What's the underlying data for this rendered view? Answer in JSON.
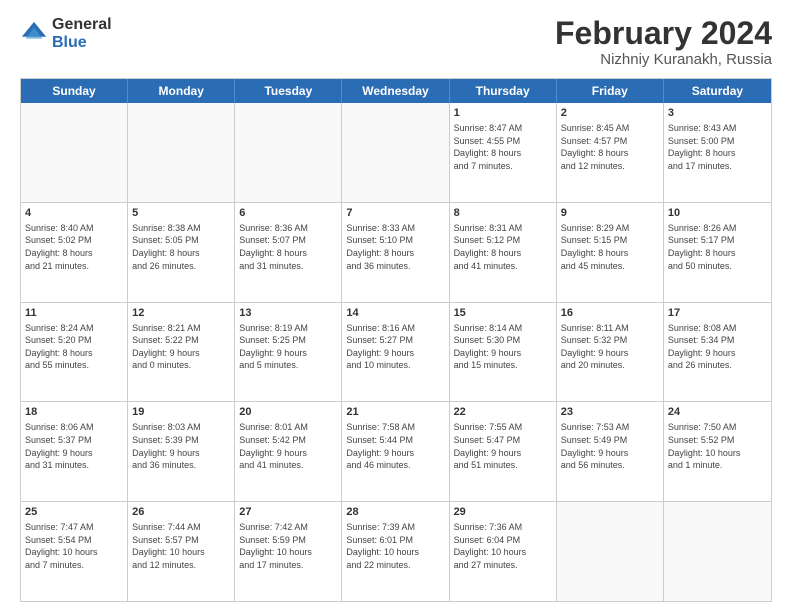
{
  "header": {
    "logo": {
      "general": "General",
      "blue": "Blue"
    },
    "title": "February 2024",
    "location": "Nizhniy Kuranakh, Russia"
  },
  "days_of_week": [
    "Sunday",
    "Monday",
    "Tuesday",
    "Wednesday",
    "Thursday",
    "Friday",
    "Saturday"
  ],
  "weeks": [
    [
      {
        "day": "",
        "empty": true
      },
      {
        "day": "",
        "empty": true
      },
      {
        "day": "",
        "empty": true
      },
      {
        "day": "",
        "empty": true
      },
      {
        "day": "1",
        "lines": [
          "Sunrise: 8:47 AM",
          "Sunset: 4:55 PM",
          "Daylight: 8 hours",
          "and 7 minutes."
        ]
      },
      {
        "day": "2",
        "lines": [
          "Sunrise: 8:45 AM",
          "Sunset: 4:57 PM",
          "Daylight: 8 hours",
          "and 12 minutes."
        ]
      },
      {
        "day": "3",
        "lines": [
          "Sunrise: 8:43 AM",
          "Sunset: 5:00 PM",
          "Daylight: 8 hours",
          "and 17 minutes."
        ]
      }
    ],
    [
      {
        "day": "4",
        "lines": [
          "Sunrise: 8:40 AM",
          "Sunset: 5:02 PM",
          "Daylight: 8 hours",
          "and 21 minutes."
        ]
      },
      {
        "day": "5",
        "lines": [
          "Sunrise: 8:38 AM",
          "Sunset: 5:05 PM",
          "Daylight: 8 hours",
          "and 26 minutes."
        ]
      },
      {
        "day": "6",
        "lines": [
          "Sunrise: 8:36 AM",
          "Sunset: 5:07 PM",
          "Daylight: 8 hours",
          "and 31 minutes."
        ]
      },
      {
        "day": "7",
        "lines": [
          "Sunrise: 8:33 AM",
          "Sunset: 5:10 PM",
          "Daylight: 8 hours",
          "and 36 minutes."
        ]
      },
      {
        "day": "8",
        "lines": [
          "Sunrise: 8:31 AM",
          "Sunset: 5:12 PM",
          "Daylight: 8 hours",
          "and 41 minutes."
        ]
      },
      {
        "day": "9",
        "lines": [
          "Sunrise: 8:29 AM",
          "Sunset: 5:15 PM",
          "Daylight: 8 hours",
          "and 45 minutes."
        ]
      },
      {
        "day": "10",
        "lines": [
          "Sunrise: 8:26 AM",
          "Sunset: 5:17 PM",
          "Daylight: 8 hours",
          "and 50 minutes."
        ]
      }
    ],
    [
      {
        "day": "11",
        "lines": [
          "Sunrise: 8:24 AM",
          "Sunset: 5:20 PM",
          "Daylight: 8 hours",
          "and 55 minutes."
        ]
      },
      {
        "day": "12",
        "lines": [
          "Sunrise: 8:21 AM",
          "Sunset: 5:22 PM",
          "Daylight: 9 hours",
          "and 0 minutes."
        ]
      },
      {
        "day": "13",
        "lines": [
          "Sunrise: 8:19 AM",
          "Sunset: 5:25 PM",
          "Daylight: 9 hours",
          "and 5 minutes."
        ]
      },
      {
        "day": "14",
        "lines": [
          "Sunrise: 8:16 AM",
          "Sunset: 5:27 PM",
          "Daylight: 9 hours",
          "and 10 minutes."
        ]
      },
      {
        "day": "15",
        "lines": [
          "Sunrise: 8:14 AM",
          "Sunset: 5:30 PM",
          "Daylight: 9 hours",
          "and 15 minutes."
        ]
      },
      {
        "day": "16",
        "lines": [
          "Sunrise: 8:11 AM",
          "Sunset: 5:32 PM",
          "Daylight: 9 hours",
          "and 20 minutes."
        ]
      },
      {
        "day": "17",
        "lines": [
          "Sunrise: 8:08 AM",
          "Sunset: 5:34 PM",
          "Daylight: 9 hours",
          "and 26 minutes."
        ]
      }
    ],
    [
      {
        "day": "18",
        "lines": [
          "Sunrise: 8:06 AM",
          "Sunset: 5:37 PM",
          "Daylight: 9 hours",
          "and 31 minutes."
        ]
      },
      {
        "day": "19",
        "lines": [
          "Sunrise: 8:03 AM",
          "Sunset: 5:39 PM",
          "Daylight: 9 hours",
          "and 36 minutes."
        ]
      },
      {
        "day": "20",
        "lines": [
          "Sunrise: 8:01 AM",
          "Sunset: 5:42 PM",
          "Daylight: 9 hours",
          "and 41 minutes."
        ]
      },
      {
        "day": "21",
        "lines": [
          "Sunrise: 7:58 AM",
          "Sunset: 5:44 PM",
          "Daylight: 9 hours",
          "and 46 minutes."
        ]
      },
      {
        "day": "22",
        "lines": [
          "Sunrise: 7:55 AM",
          "Sunset: 5:47 PM",
          "Daylight: 9 hours",
          "and 51 minutes."
        ]
      },
      {
        "day": "23",
        "lines": [
          "Sunrise: 7:53 AM",
          "Sunset: 5:49 PM",
          "Daylight: 9 hours",
          "and 56 minutes."
        ]
      },
      {
        "day": "24",
        "lines": [
          "Sunrise: 7:50 AM",
          "Sunset: 5:52 PM",
          "Daylight: 10 hours",
          "and 1 minute."
        ]
      }
    ],
    [
      {
        "day": "25",
        "lines": [
          "Sunrise: 7:47 AM",
          "Sunset: 5:54 PM",
          "Daylight: 10 hours",
          "and 7 minutes."
        ]
      },
      {
        "day": "26",
        "lines": [
          "Sunrise: 7:44 AM",
          "Sunset: 5:57 PM",
          "Daylight: 10 hours",
          "and 12 minutes."
        ]
      },
      {
        "day": "27",
        "lines": [
          "Sunrise: 7:42 AM",
          "Sunset: 5:59 PM",
          "Daylight: 10 hours",
          "and 17 minutes."
        ]
      },
      {
        "day": "28",
        "lines": [
          "Sunrise: 7:39 AM",
          "Sunset: 6:01 PM",
          "Daylight: 10 hours",
          "and 22 minutes."
        ]
      },
      {
        "day": "29",
        "lines": [
          "Sunrise: 7:36 AM",
          "Sunset: 6:04 PM",
          "Daylight: 10 hours",
          "and 27 minutes."
        ]
      },
      {
        "day": "",
        "empty": true
      },
      {
        "day": "",
        "empty": true
      }
    ]
  ]
}
